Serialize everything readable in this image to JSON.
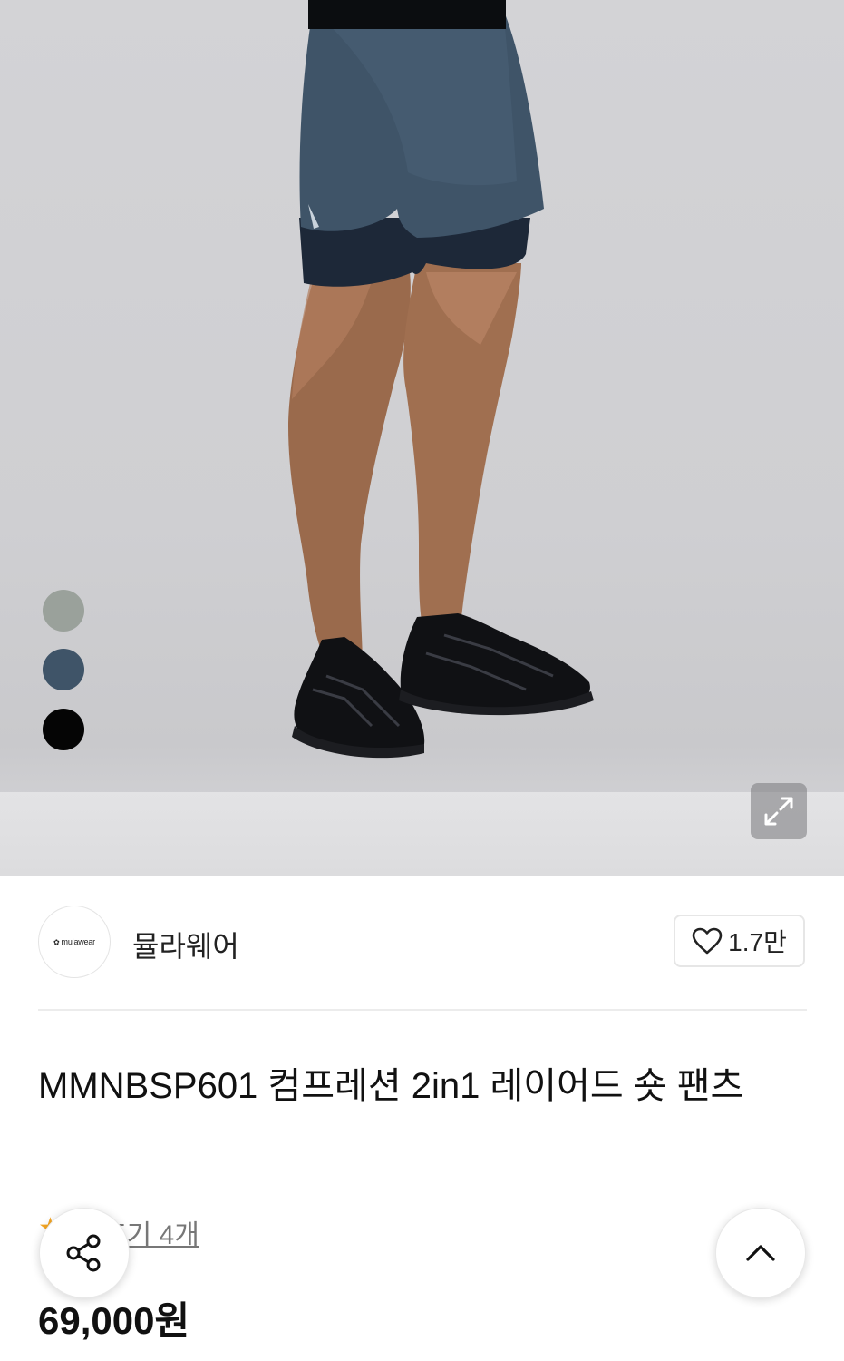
{
  "product": {
    "color_swatches": [
      {
        "name": "sage-gray",
        "color": "#9aa19b"
      },
      {
        "name": "navy-slate",
        "color": "#3f5468"
      },
      {
        "name": "black",
        "color": "#050505"
      }
    ],
    "title": "MMNBSP601 컴프레션 2in1 레이어드 숏 팬츠",
    "price": "69,000원"
  },
  "brand": {
    "logo_text": "mulawear",
    "name": "뮬라웨어",
    "like_count": "1.7만"
  },
  "reviews": {
    "link_text": "후기 4개"
  },
  "icons": {
    "expand": "expand-icon",
    "like": "heart-icon",
    "share": "share-icon",
    "scroll_top": "chevron-up-icon",
    "rating": "star-icon"
  }
}
